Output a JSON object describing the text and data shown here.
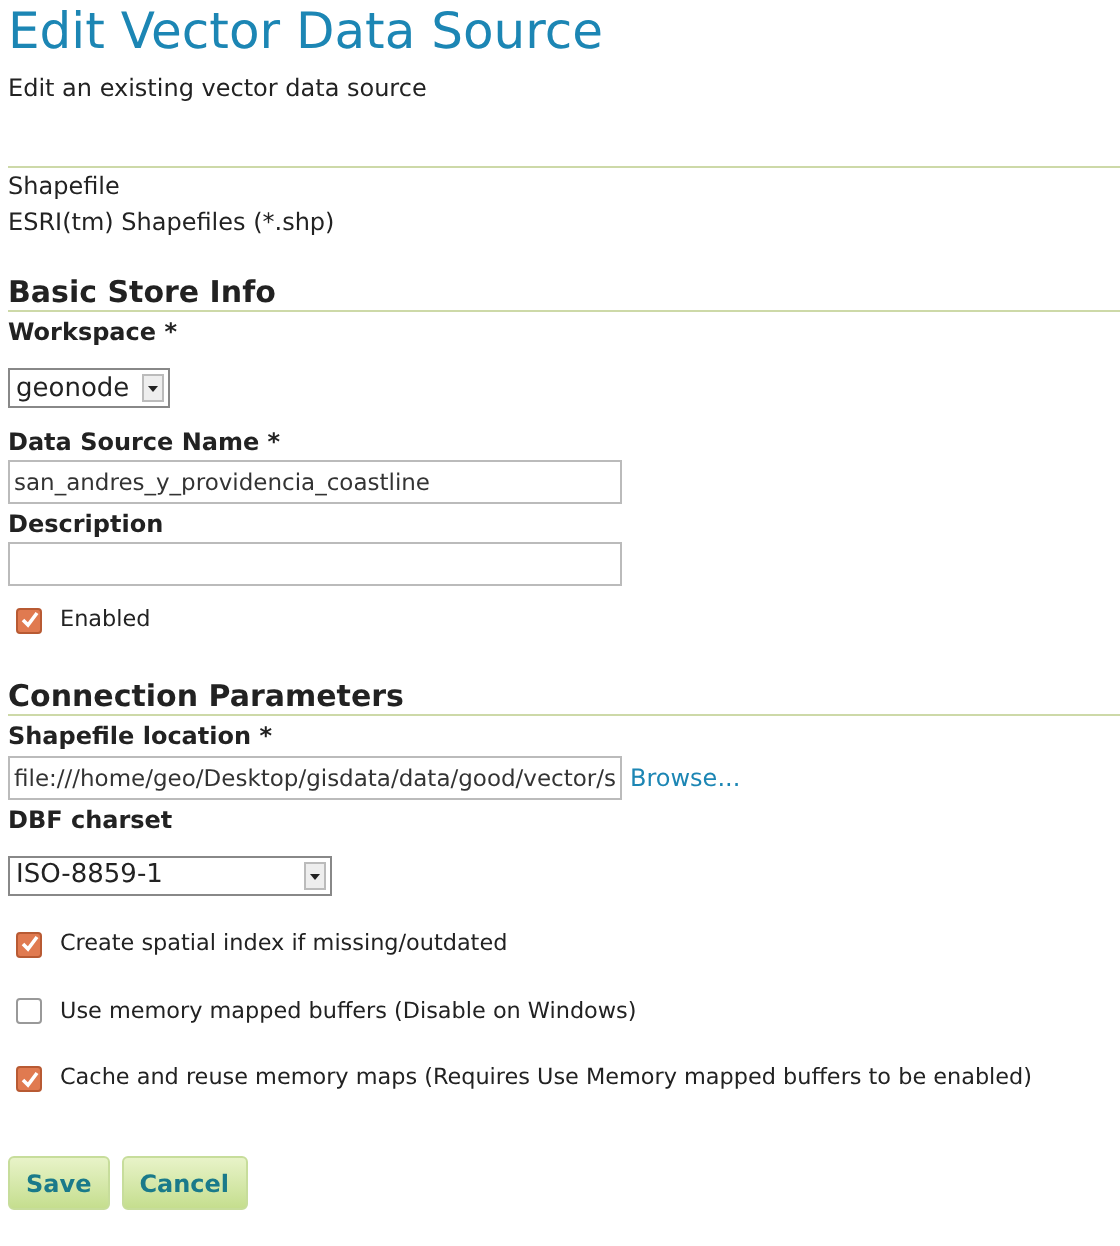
{
  "title": "Edit Vector Data Source",
  "subtitle": "Edit an existing vector data source",
  "store_type": {
    "name": "Shapefile",
    "description": "ESRI(tm) Shapefiles (*.shp)"
  },
  "basic_store_info": {
    "heading": "Basic Store Info",
    "workspace": {
      "label": "Workspace *",
      "value": "geonode"
    },
    "data_source_name": {
      "label": "Data Source Name *",
      "value": "san_andres_y_providencia_coastline"
    },
    "description": {
      "label": "Description"
    },
    "enabled": {
      "label": "Enabled",
      "checked": true
    }
  },
  "connection_parameters": {
    "heading": "Connection Parameters",
    "shapefile_location": {
      "label": "Shapefile location *",
      "value": "file:///home/geo/Desktop/gisdata/data/good/vector/s",
      "browse": "Browse..."
    },
    "dbf_charset": {
      "label": "DBF charset",
      "value": "ISO-8859-1"
    },
    "options": [
      {
        "label": "Create spatial index if missing/outdated",
        "checked": true
      },
      {
        "label": "Use memory mapped buffers (Disable on Windows)",
        "checked": false
      },
      {
        "label": "Cache and reuse memory maps (Requires Use Memory mapped buffers to be enabled)",
        "checked": true
      }
    ]
  },
  "buttons": [
    "Save",
    "Cancel"
  ]
}
